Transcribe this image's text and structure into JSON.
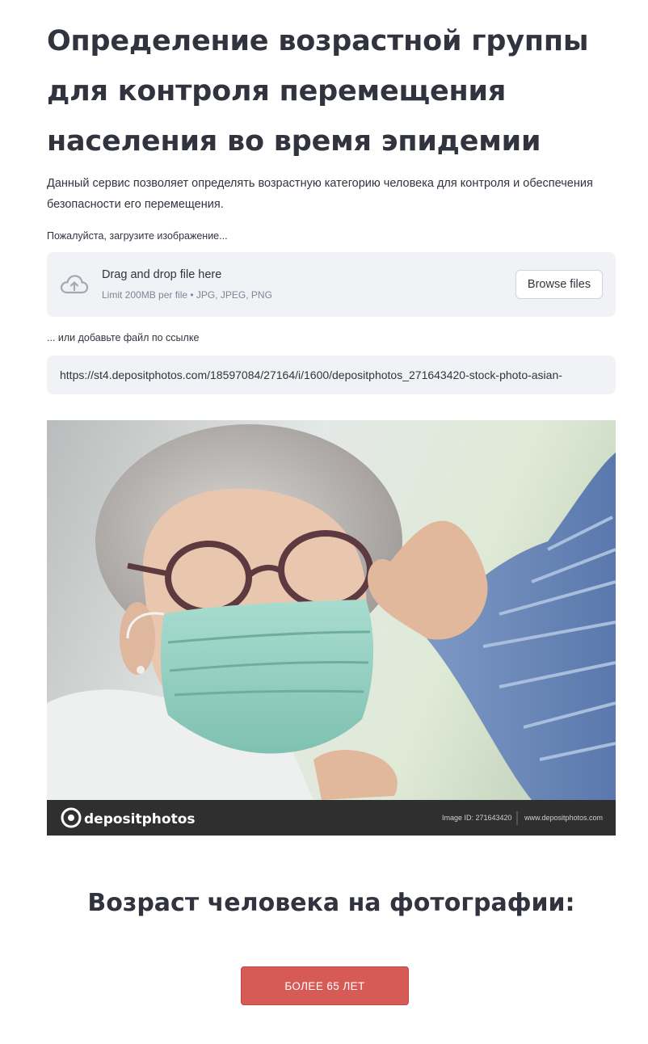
{
  "page": {
    "title": "Определение возрастной группы для контроля перемещения населения во время эпидемии",
    "description": "Данный сервис позволяет определять возрастную категорию человека для контроля и обеспечения безопасности его перемещения."
  },
  "upload": {
    "label": "Пожалуйста, загрузите изображение...",
    "dropzone_title": "Drag and drop file here",
    "dropzone_limit": "Limit 200MB per file • JPG, JPEG, PNG",
    "browse_label": "Browse files",
    "icon": "cloud-upload-icon"
  },
  "url_input": {
    "label": "... или добавьте файл по ссылке",
    "value": "https://st4.depositphotos.com/18597084/27164/i/1600/depositphotos_271643420-stock-photo-asian-"
  },
  "image": {
    "watermark_logo": "depositphotos",
    "image_id": "Image ID: 271643420",
    "site": "www.depositphotos.com"
  },
  "result": {
    "heading": "Возраст человека на фотографии:",
    "value": "БОЛЕЕ 65 ЛЕТ"
  },
  "colors": {
    "accent": "#d65b57",
    "input_bg": "#f0f2f6",
    "text": "#31333f"
  }
}
